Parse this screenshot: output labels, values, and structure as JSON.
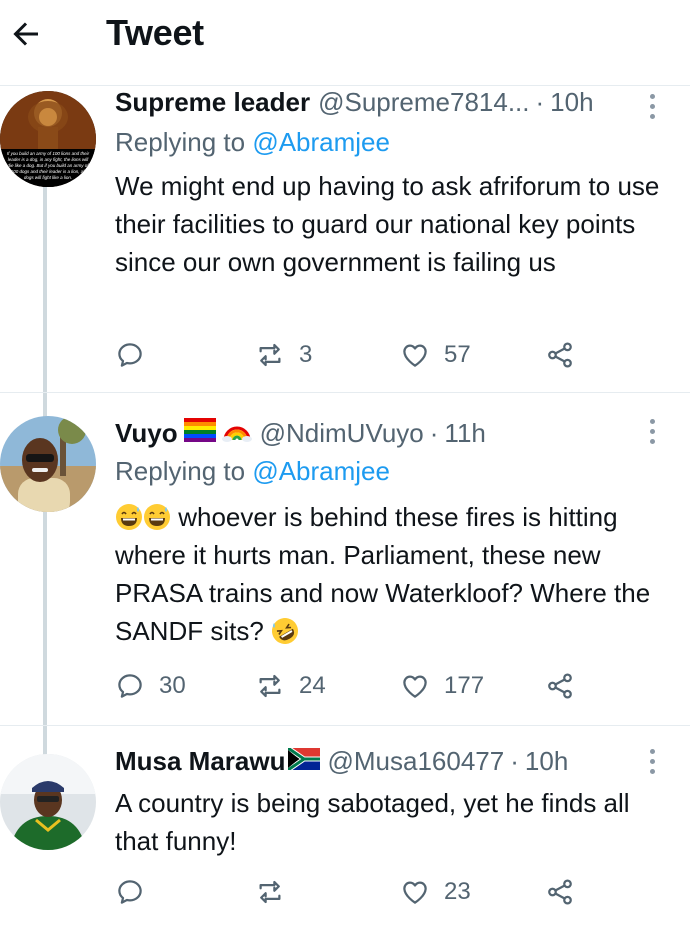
{
  "header": {
    "title": "Tweet",
    "back_icon": "arrow-left-icon"
  },
  "tweets": [
    {
      "display_name": "Supreme leader",
      "handle": "@Supreme7814...",
      "time": "10h",
      "replying_prefix": "Replying to ",
      "replying_to": "@Abramjee",
      "text": "We might end up having to ask afriforum to use their facilities to guard our national key points since our own government is failing us",
      "avatar_caption": "If you build an army of 100 lions and their leader is a dog, in any fight, the lions will die like a dog. But if you build an army of 100 dogs and their leader is a lion, all dogs will fight like a lion.",
      "reply_count": "",
      "retweet_count": "3",
      "like_count": "57"
    },
    {
      "display_name": "Vuyo",
      "handle": "@NdimUVuyo",
      "time": "11h",
      "replying_prefix": "Replying to ",
      "replying_to": "@Abramjee",
      "text_main": "whoever is behind these fires is hitting where it hurts man. Parliament, these new PRASA trains and now Waterkloof? Where the SANDF sits?",
      "reply_count": "30",
      "retweet_count": "24",
      "like_count": "177"
    },
    {
      "display_name": "Musa Marawu",
      "handle": "@Musa160477",
      "time": "10h",
      "text": "A country is being sabotaged, yet he finds all that funny!",
      "reply_count": "",
      "retweet_count": "",
      "like_count": "23"
    }
  ],
  "colors": {
    "accent": "#1d9bf0",
    "secondary_text": "#536471",
    "divider": "#e6ecf0",
    "thread_line": "#cfd9de"
  }
}
